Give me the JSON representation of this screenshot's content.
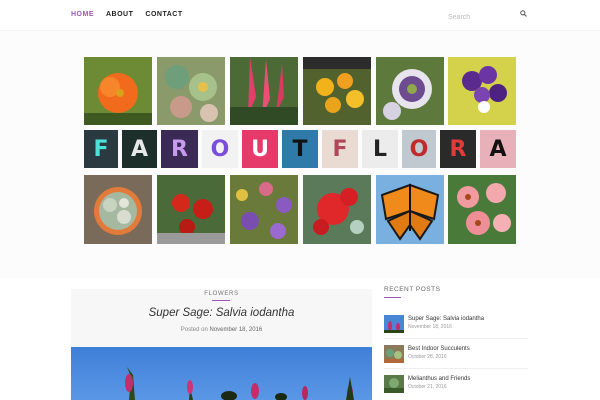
{
  "nav": {
    "items": [
      {
        "label": "HOME",
        "active": true
      },
      {
        "label": "ABOUT",
        "active": false
      },
      {
        "label": "CONTACT",
        "active": false
      }
    ],
    "search_placeholder": "Search",
    "search_icon": "search-icon"
  },
  "collage": {
    "letters": [
      "F",
      "A",
      "R",
      "O",
      "U",
      "T",
      "F",
      "L",
      "O",
      "R",
      "A"
    ]
  },
  "post": {
    "category": "FLOWERS",
    "title": "Super Sage: Salvia iodantha",
    "meta_prefix": "Posted on",
    "date": "November 18, 2016"
  },
  "sidebar": {
    "heading": "RECENT POSTS",
    "items": [
      {
        "title": "Super Sage: Salvia iodantha",
        "date": "November 18, 2016"
      },
      {
        "title": "Best Indoor Succulents",
        "date": "October 28, 2016"
      },
      {
        "title": "Melianthus and Friends",
        "date": "October 21, 2016"
      }
    ]
  },
  "colors": {
    "accent": "#9b59b6"
  }
}
